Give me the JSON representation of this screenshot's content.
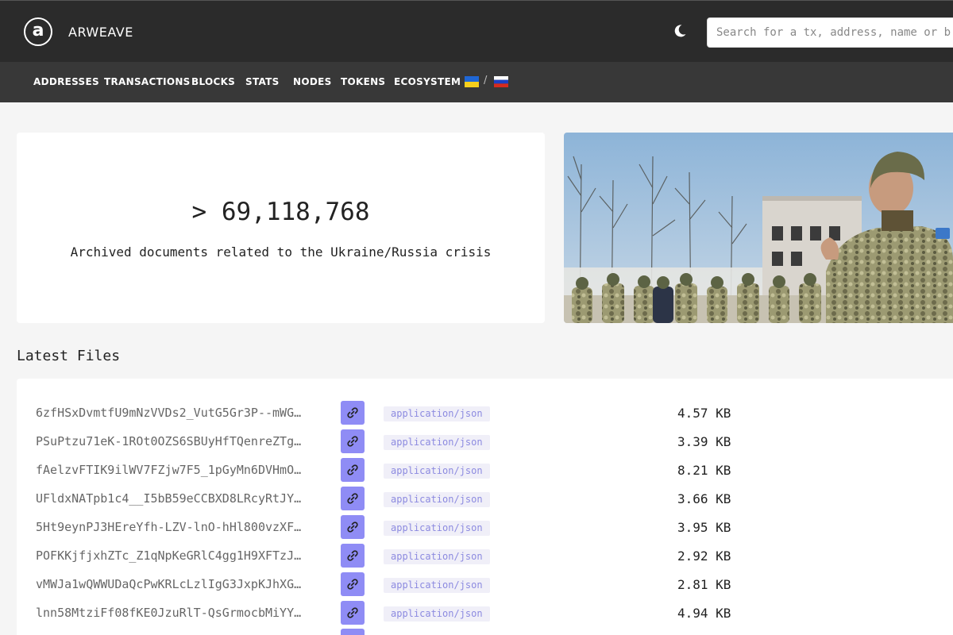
{
  "header": {
    "logo_letter": "a",
    "brand": "ARWEAVE",
    "search_placeholder": "Search for a tx, address, name or block"
  },
  "nav": {
    "items": [
      "ADDRESSES",
      "TRANSACTIONS",
      "BLOCKS",
      "STATS",
      "NODES",
      "TOKENS",
      "ECOSYSTEM"
    ],
    "flag_separator": "/",
    "flags": [
      "ukraine-flag",
      "russia-flag"
    ]
  },
  "stat": {
    "count": "> 69,118,768",
    "caption": "Archived documents related to the Ukraine/Russia crisis"
  },
  "latest_files": {
    "title": "Latest Files",
    "rows": [
      {
        "id": "6zfHSxDvmtfU9mNzVVDs2_VutG5Gr3P--mWG…",
        "type": "application/json",
        "size": "4.57 KB"
      },
      {
        "id": "PSuPtzu71eK-1ROt0OZS6SBUyHfTQenreZTg…",
        "type": "application/json",
        "size": "3.39 KB"
      },
      {
        "id": "fAelzvFTIK9ilWV7FZjw7F5_1pGyMn6DVHmO…",
        "type": "application/json",
        "size": "8.21 KB"
      },
      {
        "id": "UFldxNATpb1c4__I5bB59eCCBXD8LRcyRtJY…",
        "type": "application/json",
        "size": "3.66 KB"
      },
      {
        "id": "5Ht9eynPJ3HEreYfh-LZV-lnO-hHl800vzXF…",
        "type": "application/json",
        "size": "3.95 KB"
      },
      {
        "id": "POFKKjfjxhZTc_Z1qNpKeGRlC4gg1H9XFTzJ…",
        "type": "application/json",
        "size": "2.92 KB"
      },
      {
        "id": "vMWJa1wQWWUDaQcPwKRLcLzlIgG3JxpKJhXG…",
        "type": "application/json",
        "size": "2.81 KB"
      },
      {
        "id": "lnn58MtziFf08fKE0JzuRlT-QsGrmocbMiYY…",
        "type": "application/json",
        "size": "4.94 KB"
      }
    ]
  },
  "colors": {
    "topbar": "#2b2b2b",
    "navbar": "#383838",
    "accent": "#8f8cf5",
    "mime_bg": "#f0eff8",
    "mime_text": "#8c8ae0"
  }
}
